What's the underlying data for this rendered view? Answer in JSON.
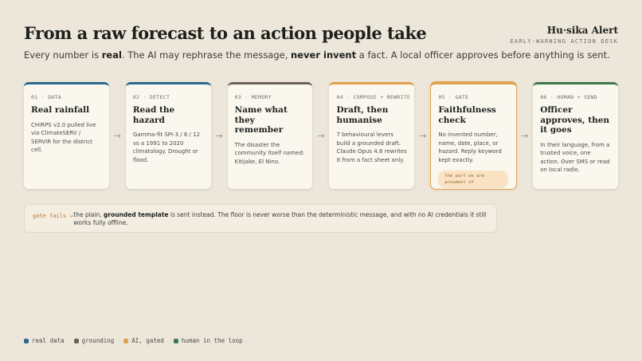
{
  "header": {
    "title": "From a raw forecast to an action people take",
    "subtitle_parts": [
      "Every number is ",
      "real",
      ". The AI may rephrase the message, ",
      "never invent",
      " a fact. A local officer approves before anything is sent."
    ],
    "brand": "Hu·sika Alert",
    "brand_sub": "EARLY-WARNING ACTION DESK"
  },
  "steps": [
    {
      "num": "01 · DATA",
      "title": "Real rainfall",
      "body": "CHIRPS v2.0 pulled live via ClimateSERV / SERVIR for the district cell.",
      "category": "real data"
    },
    {
      "num": "02 · DETECT",
      "title": "Read the hazard",
      "body": "Gamma-fit SPI-3 / 6 / 12 vs a 1991 to 2020 climatology. Drought or flood.",
      "category": "real data"
    },
    {
      "num": "03 · MEMORY",
      "title": "Name what they remember",
      "body": "The disaster the community itself named: Kitijake, El Nino.",
      "category": "grounding"
    },
    {
      "num": "04 · COMPOSE + REWRITE",
      "title": "Draft, then humanise",
      "body": "7 behavioural levers build a grounded draft. Claude Opus 4.8 rewrites it from a fact sheet only.",
      "category": "AI, gated"
    },
    {
      "num": "05 · GATE",
      "title": "Faithfulness check",
      "body": "No invented number, name, date, place, or hazard. Reply keyword kept exactly.",
      "pill": "the part we are proudest of",
      "category": "AI, gated"
    },
    {
      "num": "06 · HUMAN + SEND",
      "title": "Officer approves, then it goes",
      "body": "In their language, from a trusted voice, one action. Over SMS or read on local radio.",
      "category": "human in the loop"
    }
  ],
  "arrow_glyph": "→",
  "gate_fails": {
    "label": "gate fails →",
    "text_parts": [
      "the plain, ",
      "grounded template",
      " is sent instead. The floor is never worse than the deterministic message, and with no AI credentials it still works fully offline."
    ]
  },
  "legend": [
    {
      "label": "real data",
      "color": "#2a6a8c"
    },
    {
      "label": "grounding",
      "color": "#6b6357"
    },
    {
      "label": "AI, gated",
      "color": "#e0a24f"
    },
    {
      "label": "human in the loop",
      "color": "#3d7a4e"
    }
  ]
}
